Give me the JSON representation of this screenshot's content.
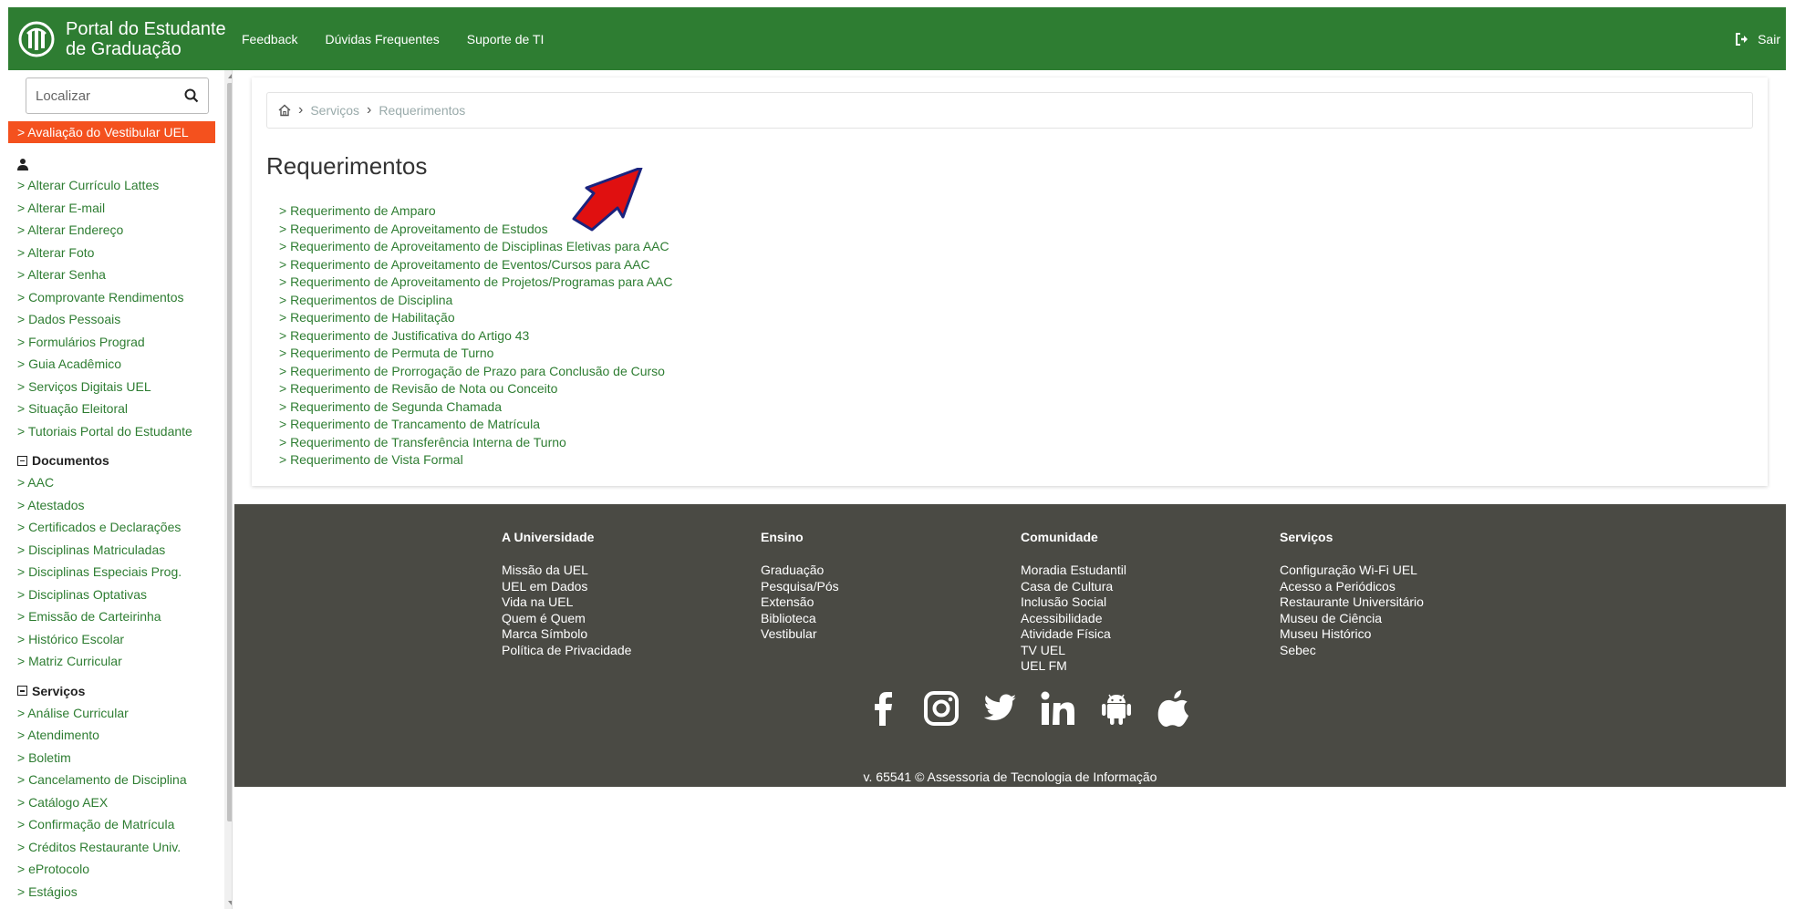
{
  "header": {
    "title_line1": "Portal do Estudante",
    "title_line2": "de Graduação",
    "nav": [
      "Feedback",
      "Dúvidas Frequentes",
      "Suporte de TI"
    ],
    "logout": "Sair",
    "color": "#2e7d32"
  },
  "sidebar": {
    "search_placeholder": "Localizar",
    "highlight": "> Avaliação do Vestibular UEL",
    "user_items": [
      "> Alterar Currículo Lattes",
      "> Alterar E-mail",
      "> Alterar Endereço",
      "> Alterar Foto",
      "> Alterar Senha",
      "> Comprovante Rendimentos",
      "> Dados Pessoais",
      "> Formulários Prograd",
      "> Guia Acadêmico",
      "> Serviços Digitais UEL",
      "> Situação Eleitoral",
      "> Tutoriais Portal do Estudante"
    ],
    "documentos_title": "Documentos",
    "documentos_items": [
      "> AAC",
      "> Atestados",
      "> Certificados e Declarações",
      "> Disciplinas Matriculadas",
      "> Disciplinas Especiais Prog.",
      "> Disciplinas Optativas",
      "> Emissão de Carteirinha",
      "> Histórico Escolar",
      "> Matriz Curricular"
    ],
    "servicos_title": "Serviços",
    "servicos_items": [
      "> Análise Curricular",
      "> Atendimento",
      "> Boletim",
      "> Cancelamento de Disciplina",
      "> Catálogo AEX",
      "> Confirmação de Matrícula",
      "> Créditos Restaurante Univ.",
      "> eProtocolo",
      "> Estágios"
    ]
  },
  "breadcrumb": {
    "items": [
      "Serviços",
      "Requerimentos"
    ]
  },
  "main": {
    "title": "Requerimentos",
    "items": [
      "> Requerimento de Amparo",
      "> Requerimento de Aproveitamento de Estudos",
      "> Requerimento de Aproveitamento de Disciplinas Eletivas para AAC",
      "> Requerimento de Aproveitamento de Eventos/Cursos para AAC",
      "> Requerimento de Aproveitamento de Projetos/Programas para AAC",
      "> Requerimentos de Disciplina",
      "> Requerimento de Habilitação",
      "> Requerimento de Justificativa do Artigo 43",
      "> Requerimento de Permuta de Turno",
      "> Requerimento de Prorrogação de Prazo para Conclusão de Curso",
      "> Requerimento de Revisão de Nota ou Conceito",
      "> Requerimento de Segunda Chamada",
      "> Requerimento de Trancamento de Matrícula",
      "> Requerimento de Transferência Interna de Turno",
      "> Requerimento de Vista Formal"
    ]
  },
  "footer": {
    "columns": [
      {
        "title": "A Universidade",
        "links": [
          "Missão da UEL",
          "UEL em Dados",
          "Vida na UEL",
          "Quem é Quem",
          "Marca Símbolo",
          "Política de Privacidade"
        ]
      },
      {
        "title": "Ensino",
        "links": [
          "Graduação",
          "Pesquisa/Pós",
          "Extensão",
          "Biblioteca",
          "Vestibular"
        ]
      },
      {
        "title": "Comunidade",
        "links": [
          "Moradia Estudantil",
          "Casa de Cultura",
          "Inclusão Social",
          "Acessibilidade",
          "Atividade Física",
          "TV UEL",
          "UEL FM"
        ]
      },
      {
        "title": "Serviços",
        "links": [
          "Configuração Wi-Fi UEL",
          "Acesso a Periódicos",
          "Restaurante Universitário",
          "Museu de Ciência",
          "Museu Histórico",
          "Sebec"
        ]
      }
    ],
    "socials": [
      "facebook-icon",
      "instagram-icon",
      "twitter-icon",
      "linkedin-icon",
      "android-icon",
      "apple-icon"
    ],
    "version": "v. 65541 © Assessoria de Tecnologia de Informação",
    "bg_color": "#4a4a44"
  },
  "accent_colors": {
    "highlight": "#f4511e",
    "link": "#2e7d32",
    "annotation_arrow": "#e01010"
  }
}
